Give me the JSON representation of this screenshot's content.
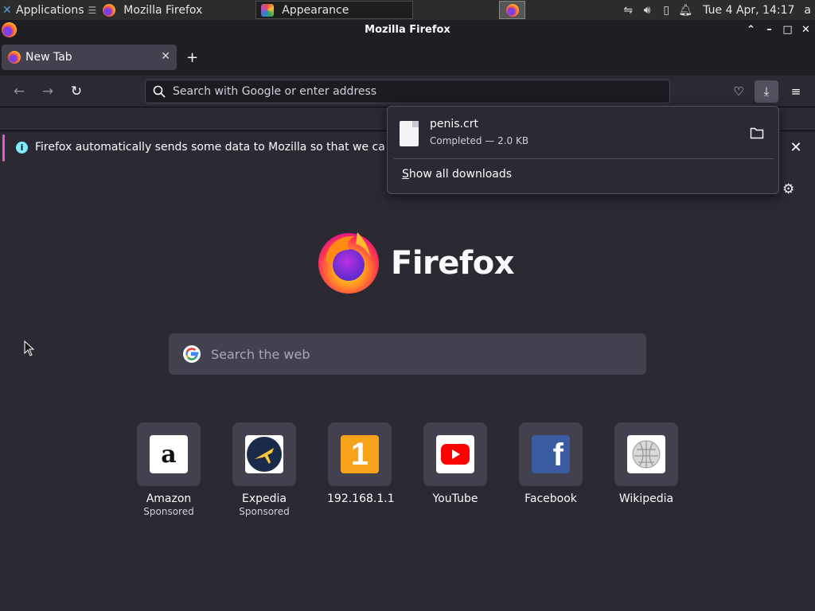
{
  "panel": {
    "applications_label": "Applications",
    "task_firefox": "Mozilla Firefox",
    "task_appearance": "Appearance",
    "clock": "Tue  4 Apr, 14:17",
    "user_initial": "a"
  },
  "window": {
    "title": "Mozilla Firefox"
  },
  "tabs": [
    {
      "label": "New Tab"
    }
  ],
  "urlbar": {
    "placeholder": "Search with Google or enter address"
  },
  "notification": {
    "text": "Firefox automatically sends some data to Mozilla so that we can improve your experience."
  },
  "downloads": {
    "file_name": "penis.crt",
    "status": "Completed — 2.0 KB",
    "show_all_first": "S",
    "show_all_rest": "how all downloads"
  },
  "newtab": {
    "brand": "Firefox",
    "search_placeholder": "Search the web",
    "top_sites": [
      {
        "name": "Amazon",
        "sub": "Sponsored",
        "icon": "amazon-icon"
      },
      {
        "name": "Expedia",
        "sub": "Sponsored",
        "icon": "expedia-icon"
      },
      {
        "name": "192.168.1.1",
        "sub": "",
        "icon": "number-one-icon"
      },
      {
        "name": "YouTube",
        "sub": "",
        "icon": "youtube-icon"
      },
      {
        "name": "Facebook",
        "sub": "",
        "icon": "facebook-icon"
      },
      {
        "name": "Wikipedia",
        "sub": "",
        "icon": "wikipedia-icon"
      }
    ]
  },
  "colors": {
    "background": "#2b2a33",
    "toolbar": "#1f1e25",
    "tile": "#42414d",
    "accent_info": "#80ebff",
    "accent_bar": "#e05ac8"
  }
}
